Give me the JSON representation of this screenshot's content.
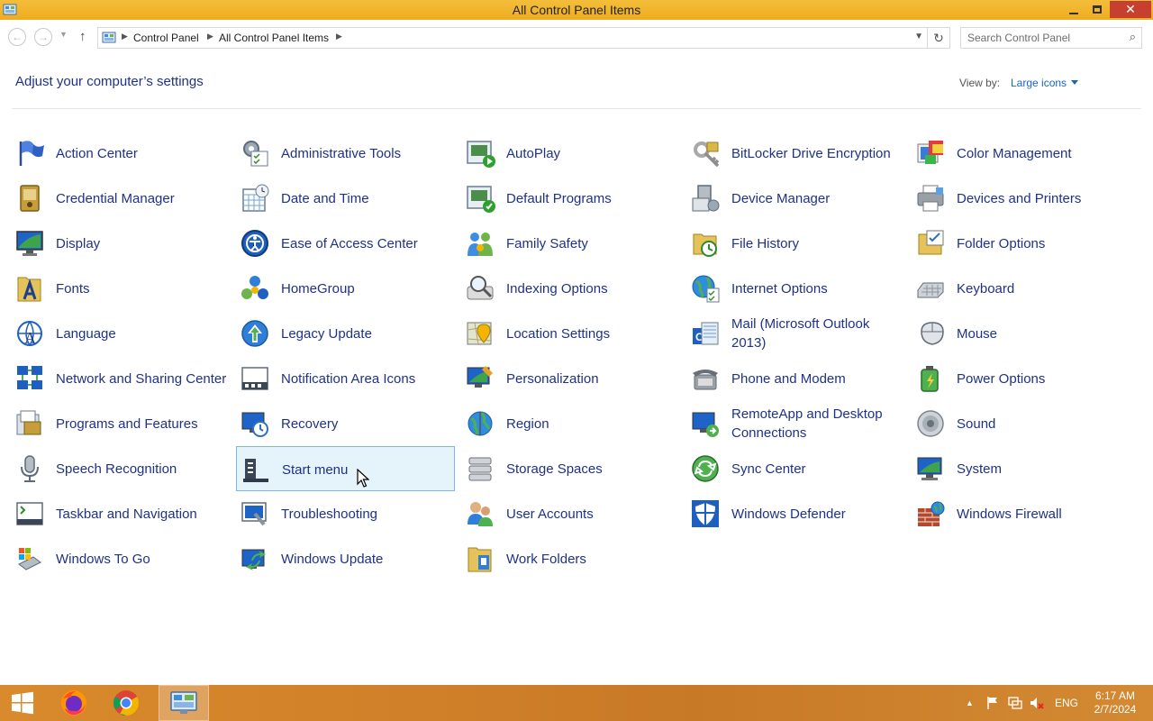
{
  "window": {
    "title": "All Control Panel Items",
    "close_glyph": "✕"
  },
  "address": {
    "crumbs": [
      "Control Panel",
      "All Control Panel Items"
    ],
    "search_placeholder": "Search Control Panel"
  },
  "header": {
    "title": "Adjust your computer’s settings",
    "view_by_label": "View by:",
    "view_by_value": "Large icons"
  },
  "items": [
    {
      "label": "Action Center",
      "icon": "flag-icon"
    },
    {
      "label": "Administrative Tools",
      "icon": "admin-tools-icon"
    },
    {
      "label": "AutoPlay",
      "icon": "autoplay-icon"
    },
    {
      "label": "BitLocker Drive Encryption",
      "icon": "bitlocker-key-icon"
    },
    {
      "label": "Color Management",
      "icon": "color-management-icon"
    },
    {
      "label": "Credential Manager",
      "icon": "credential-vault-icon"
    },
    {
      "label": "Date and Time",
      "icon": "calendar-clock-icon"
    },
    {
      "label": "Default Programs",
      "icon": "default-programs-icon"
    },
    {
      "label": "Device Manager",
      "icon": "device-manager-icon"
    },
    {
      "label": "Devices and Printers",
      "icon": "printer-icon"
    },
    {
      "label": "Display",
      "icon": "monitor-icon"
    },
    {
      "label": "Ease of Access Center",
      "icon": "ease-of-access-icon"
    },
    {
      "label": "Family Safety",
      "icon": "family-safety-icon"
    },
    {
      "label": "File History",
      "icon": "file-history-icon"
    },
    {
      "label": "Folder Options",
      "icon": "folder-options-icon"
    },
    {
      "label": "Fonts",
      "icon": "fonts-folder-icon"
    },
    {
      "label": "HomeGroup",
      "icon": "homegroup-icon"
    },
    {
      "label": "Indexing Options",
      "icon": "indexing-icon"
    },
    {
      "label": "Internet Options",
      "icon": "globe-icon"
    },
    {
      "label": "Keyboard",
      "icon": "keyboard-icon"
    },
    {
      "label": "Language",
      "icon": "language-icon"
    },
    {
      "label": "Legacy Update",
      "icon": "legacy-update-icon"
    },
    {
      "label": "Location Settings",
      "icon": "location-icon"
    },
    {
      "label": "Mail (Microsoft Outlook 2013)",
      "icon": "mail-icon"
    },
    {
      "label": "Mouse",
      "icon": "mouse-icon"
    },
    {
      "label": "Network and Sharing Center",
      "icon": "network-icon"
    },
    {
      "label": "Notification Area Icons",
      "icon": "notification-area-icon"
    },
    {
      "label": "Personalization",
      "icon": "personalization-icon"
    },
    {
      "label": "Phone and Modem",
      "icon": "phone-icon"
    },
    {
      "label": "Power Options",
      "icon": "power-icon"
    },
    {
      "label": "Programs and Features",
      "icon": "programs-icon"
    },
    {
      "label": "Recovery",
      "icon": "recovery-icon"
    },
    {
      "label": "Region",
      "icon": "region-globe-icon"
    },
    {
      "label": "RemoteApp and Desktop Connections",
      "icon": "remote-desktop-icon"
    },
    {
      "label": "Sound",
      "icon": "speaker-icon"
    },
    {
      "label": "Speech Recognition",
      "icon": "microphone-icon"
    },
    {
      "label": "Start menu",
      "icon": "start-menu-icon",
      "selected": true
    },
    {
      "label": "Storage Spaces",
      "icon": "storage-spaces-icon"
    },
    {
      "label": "Sync Center",
      "icon": "sync-icon"
    },
    {
      "label": "System",
      "icon": "system-icon"
    },
    {
      "label": "Taskbar and Navigation",
      "icon": "taskbar-icon"
    },
    {
      "label": "Troubleshooting",
      "icon": "troubleshooting-icon"
    },
    {
      "label": "User Accounts",
      "icon": "user-accounts-icon"
    },
    {
      "label": "Windows Defender",
      "icon": "shield-icon"
    },
    {
      "label": "Windows Firewall",
      "icon": "firewall-icon"
    },
    {
      "label": "Windows To Go",
      "icon": "usb-drive-icon"
    },
    {
      "label": "Windows Update",
      "icon": "windows-update-icon"
    },
    {
      "label": "Work Folders",
      "icon": "work-folders-icon"
    }
  ],
  "taskbar": {
    "apps": [
      "firefox-icon",
      "chrome-icon",
      "control-panel-icon"
    ],
    "language": "ENG",
    "time": "6:17 AM",
    "date": "2/7/2024"
  },
  "colors": {
    "titlebar": "#f0b428",
    "link": "#1e3287",
    "selection": "#e5f3fb",
    "taskbar": "#d08028"
  }
}
